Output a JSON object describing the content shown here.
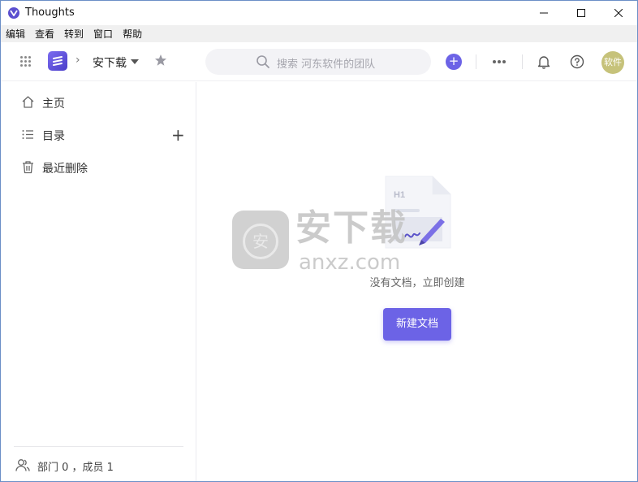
{
  "window": {
    "title": "Thoughts"
  },
  "menubar": {
    "items": [
      "编辑",
      "查看",
      "转到",
      "窗口",
      "帮助"
    ]
  },
  "toolbar": {
    "breadcrumb_label": "安下载",
    "search_placeholder": "搜索 河东软件的团队",
    "add_label": "+",
    "avatar_text": "软件"
  },
  "sidebar": {
    "items": [
      {
        "label": "主页",
        "icon": "home-icon"
      },
      {
        "label": "目录",
        "icon": "list-icon"
      },
      {
        "label": "最近删除",
        "icon": "trash-icon"
      }
    ],
    "add_label": "+",
    "footer": "部门 0 ，成员 1"
  },
  "main": {
    "illustration_heading": "H1",
    "empty_text": "没有文档，立即创建",
    "new_doc_button": "新建文档"
  },
  "watermark": {
    "badge": "安",
    "cn": "安下载",
    "en": "anxz.com"
  },
  "colors": {
    "accent": "#6c63e6",
    "avatar": "#c6c27a"
  }
}
